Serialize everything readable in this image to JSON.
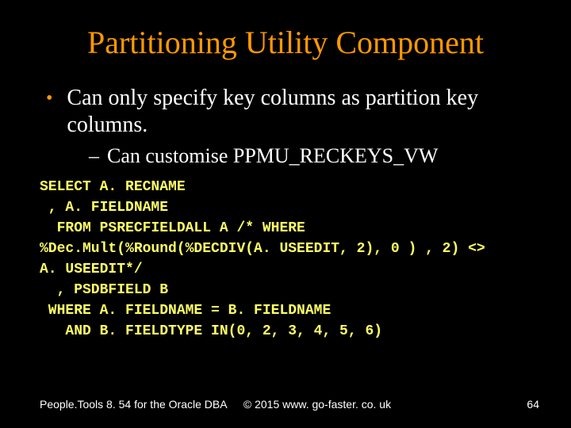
{
  "title": "Partitioning Utility Component",
  "bullets": [
    {
      "text": "Can only specify key columns as partition key columns.",
      "sub": [
        {
          "text": "Can customise PPMU_RECKEYS_VW"
        }
      ]
    }
  ],
  "code": "SELECT A. RECNAME\n , A. FIELDNAME\n  FROM PSRECFIELDALL A /* WHERE\n%Dec.Mult(%Round(%DECDIV(A. USEEDIT, 2), 0 ) , 2) <>\nA. USEEDIT*/\n  , PSDBFIELD B\n WHERE A. FIELDNAME = B. FIELDNAME\n   AND B. FIELDTYPE IN(0, 2, 3, 4, 5, 6)",
  "footer": {
    "left": "People.Tools 8. 54 for the Oracle DBA",
    "center": "© 2015 www. go-faster. co. uk",
    "right": "64"
  }
}
